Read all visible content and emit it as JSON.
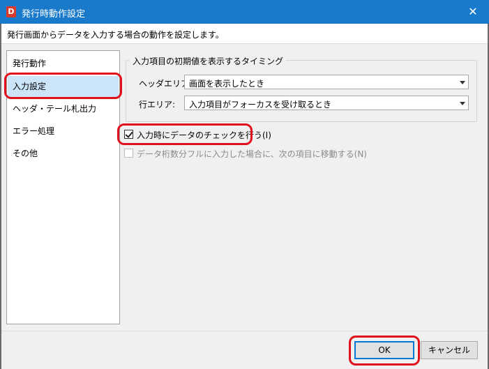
{
  "window": {
    "app_icon_letter": "D",
    "title": "発行時動作設定",
    "close_glyph": "✕"
  },
  "description": "発行画面からデータを入力する場合の動作を設定します。",
  "sidebar": {
    "items": [
      {
        "label": "発行動作",
        "selected": false
      },
      {
        "label": "入力設定",
        "selected": true
      },
      {
        "label": "ヘッダ・テール札出力",
        "selected": false
      },
      {
        "label": "エラー処理",
        "selected": false
      },
      {
        "label": "その他",
        "selected": false
      }
    ]
  },
  "timing_group": {
    "title": "入力項目の初期値を表示するタイミング",
    "header_label": "ヘッダエリア:",
    "header_value": "画面を表示したとき",
    "row_label": "行エリア:",
    "row_value": "入力項目がフォーカスを受け取るとき"
  },
  "options": {
    "check_data": {
      "label": "入力時にデータのチェックを行う(I)",
      "checked": true
    },
    "auto_move": {
      "label": "データ桁数分フルに入力した場合に、次の項目に移動する(N)",
      "checked": false,
      "enabled": false
    }
  },
  "buttons": {
    "ok": "OK",
    "cancel": "キャンセル"
  },
  "colors": {
    "titlebar": "#1979ca",
    "selected_item": "#cce4f7",
    "highlight_ring": "#e0101c",
    "ok_border": "#0078d7"
  }
}
